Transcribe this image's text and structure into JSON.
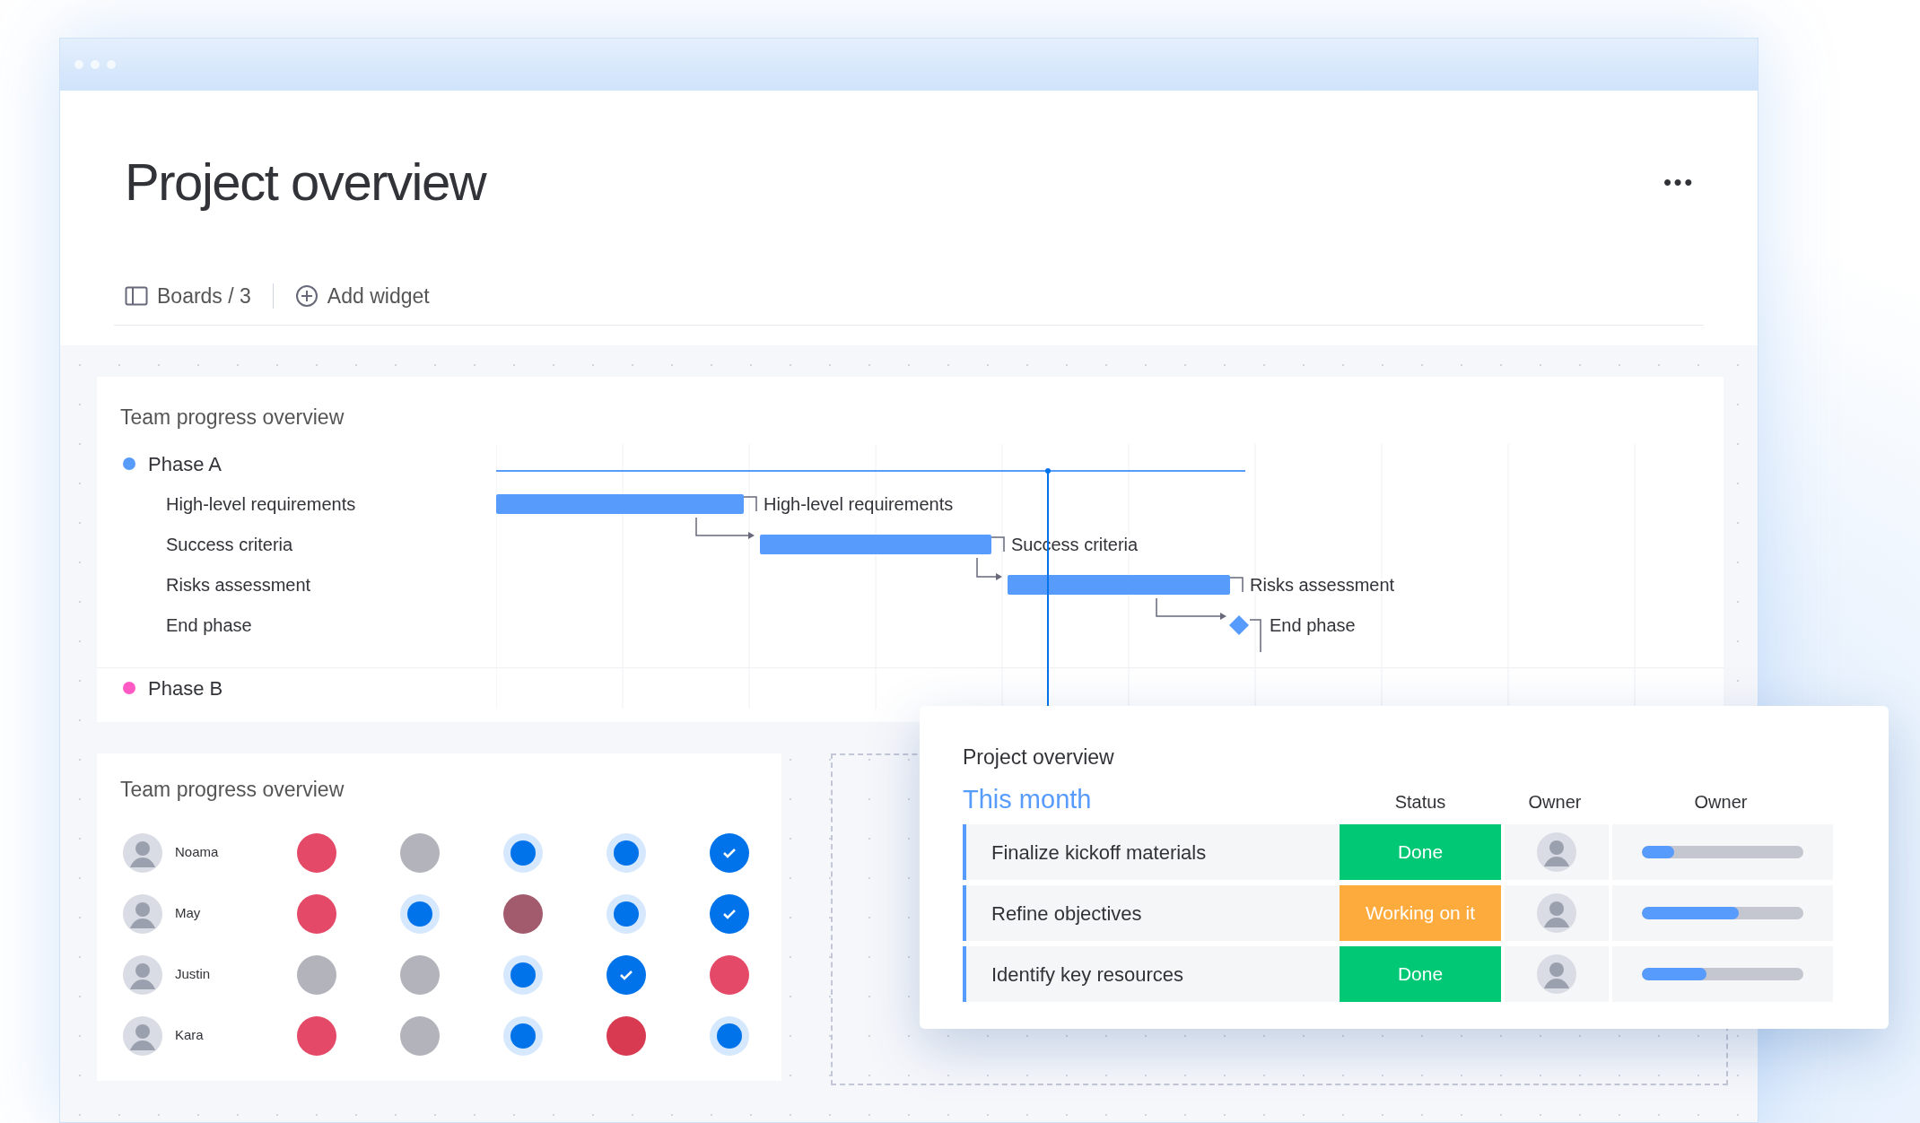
{
  "header": {
    "title": "Project overview",
    "more": "•••"
  },
  "toolbar": [
    {
      "kind": "boards",
      "label": "Boards / 3"
    },
    {
      "kind": "add",
      "label": "Add widget"
    }
  ],
  "gantt": {
    "title": "Team progress overview",
    "groups": [
      {
        "label": "Phase A",
        "color": "#579bfc",
        "tasks": [
          {
            "name": "High-level requirements",
            "bar_label": "High-level requirements"
          },
          {
            "name": "Success criteria",
            "bar_label": "Success criteria"
          },
          {
            "name": "Risks assessment",
            "bar_label": "Risks assessment"
          },
          {
            "name": "End phase",
            "bar_label": "End phase",
            "kind": "milestone"
          }
        ]
      },
      {
        "label": "Phase B",
        "color": "#ff5ac4"
      }
    ]
  },
  "team": {
    "title": "Team progress overview",
    "people": [
      {
        "name": "Noama",
        "cells": [
          {
            "kind": "solid",
            "color": "#e44a68"
          },
          {
            "kind": "solid",
            "color": "#b3b4bb"
          },
          {
            "kind": "halo",
            "color": "#0073ea"
          },
          {
            "kind": "halo",
            "color": "#0073ea"
          },
          {
            "kind": "check",
            "color": "#0073ea"
          }
        ]
      },
      {
        "name": "May",
        "cells": [
          {
            "kind": "solid",
            "color": "#e44a68"
          },
          {
            "kind": "halo",
            "color": "#0073ea"
          },
          {
            "kind": "solid",
            "color": "#a25b6c"
          },
          {
            "kind": "halo",
            "color": "#0073ea"
          },
          {
            "kind": "check",
            "color": "#0073ea"
          }
        ]
      },
      {
        "name": "Justin",
        "cells": [
          {
            "kind": "solid",
            "color": "#b3b4bb"
          },
          {
            "kind": "solid",
            "color": "#b3b4bb"
          },
          {
            "kind": "halo",
            "color": "#0073ea"
          },
          {
            "kind": "check",
            "color": "#0073ea"
          },
          {
            "kind": "solid",
            "color": "#e44a68"
          }
        ]
      },
      {
        "name": "Kara",
        "cells": [
          {
            "kind": "solid",
            "color": "#e44a68"
          },
          {
            "kind": "solid",
            "color": "#b3b4bb"
          },
          {
            "kind": "halo",
            "color": "#0073ea"
          },
          {
            "kind": "solid",
            "color": "#d83a52"
          },
          {
            "kind": "halo",
            "color": "#0073ea"
          }
        ]
      }
    ]
  },
  "board": {
    "title": "Project overview",
    "group": "This month",
    "columns": [
      "Status",
      "Owner",
      "Owner"
    ],
    "rows": [
      {
        "name": "Finalize kickoff materials",
        "status": "Done",
        "color": "#00c875",
        "level": 0.2
      },
      {
        "name": "Refine objectives",
        "status": "Working on it",
        "color": "#fdab3d",
        "level": 0.6
      },
      {
        "name": "Identify key resources",
        "status": "Done",
        "color": "#00c875",
        "level": 0.4
      }
    ]
  }
}
